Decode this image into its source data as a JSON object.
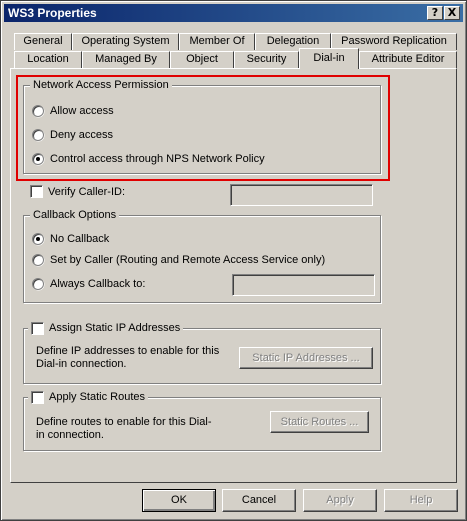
{
  "window": {
    "title": "WS3 Properties",
    "help_label": "?",
    "close_label": "X"
  },
  "tabs": {
    "row1": [
      "General",
      "Operating System",
      "Member Of",
      "Delegation",
      "Password Replication"
    ],
    "row2": [
      "Location",
      "Managed By",
      "Object",
      "Security",
      "Dial-in",
      "Attribute Editor"
    ],
    "selected": "Dial-in"
  },
  "network_access": {
    "legend": "Network Access Permission",
    "options": [
      "Allow access",
      "Deny access",
      "Control access through NPS Network Policy"
    ],
    "selected_index": 2
  },
  "verify_caller_id": {
    "label": "Verify Caller-ID:",
    "checked": false,
    "value": ""
  },
  "callback": {
    "legend": "Callback Options",
    "options": [
      "No Callback",
      "Set by Caller (Routing and Remote Access Service only)",
      "Always Callback to:"
    ],
    "selected_index": 0,
    "callback_number": ""
  },
  "static_ip": {
    "label": "Assign Static IP Addresses",
    "description": "Define IP addresses to enable for this Dial-in connection.",
    "button_label": "Static IP Addresses ..."
  },
  "static_routes": {
    "label": "Apply Static Routes",
    "description": "Define routes to enable for this Dial-in connection.",
    "button_label": "Static Routes ..."
  },
  "footer": {
    "ok_label": "OK",
    "cancel_label": "Cancel",
    "apply_label": "Apply",
    "help_label": "Help"
  },
  "colors": {
    "title_bar": "#0a246a",
    "dialog_face": "#d4d0c8",
    "highlight_border": "#e00000"
  }
}
